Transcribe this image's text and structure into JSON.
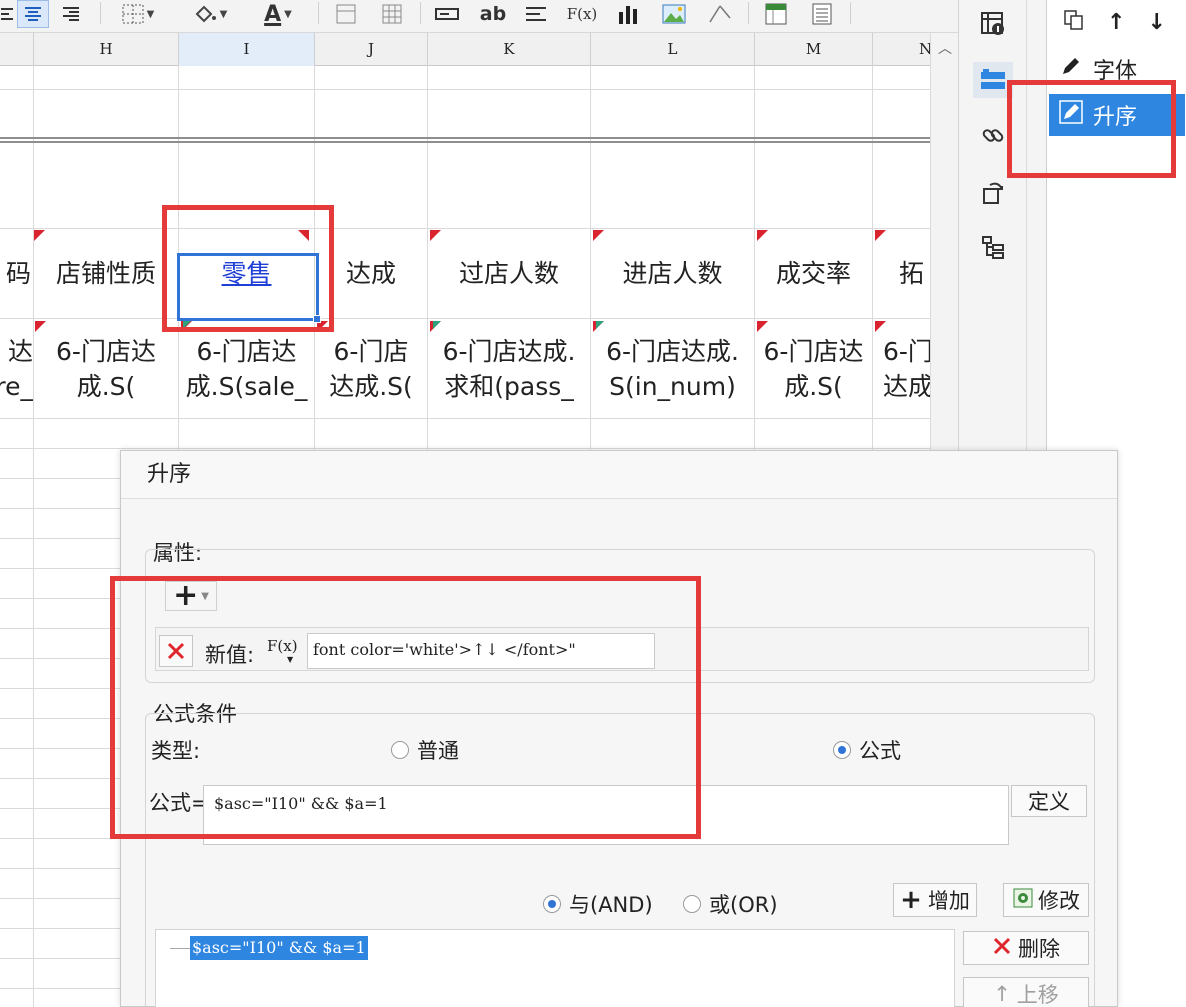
{
  "toolbar": {
    "icons": [
      "align-left-icon",
      "align-center-icon",
      "align-right-icon",
      "border-icon",
      "fill-color-icon",
      "font-color-icon",
      "merge-cells-icon",
      "table-icon",
      "text-field-icon",
      "ab-text-icon",
      "paragraph-icon",
      "formula-icon",
      "bar-chart-icon",
      "picture-icon",
      "slash-icon",
      "frozen-icon",
      "report-icon"
    ],
    "formula_label": "F(x)",
    "ab_label": "ab",
    "font_color_label": "A"
  },
  "sheet": {
    "columns": [
      "H",
      "I",
      "J",
      "K",
      "L",
      "M",
      "N"
    ],
    "selected_column": "I",
    "header_row": [
      "码",
      "店铺性质",
      "零售",
      "达成",
      "过店人数",
      "进店人数",
      "成交率",
      "拓"
    ],
    "data_row": [
      [
        "达",
        "re_"
      ],
      [
        "6-门店达",
        "成.S("
      ],
      [
        "6-门店达",
        "成.S(sale_"
      ],
      [
        "6-门店",
        "达成.S("
      ],
      [
        "6-门店达成.",
        "求和(pass_"
      ],
      [
        "6-门店达成.",
        "S(in_num)"
      ],
      [
        "6-门店达",
        "成.S("
      ],
      [
        "6-门",
        "达成"
      ]
    ]
  },
  "side_icons": [
    "cell-attr-icon",
    "condition-attr-icon",
    "hyperlink-icon",
    "widget-icon",
    "structure-icon"
  ],
  "panel": {
    "toolbar_icons": [
      "copy-icon",
      "arrow-up-icon",
      "arrow-down-icon"
    ],
    "items": [
      {
        "label": "字体",
        "icon": "pencil-icon"
      },
      {
        "label": "升序",
        "icon": "pencil-icon"
      }
    ]
  },
  "dialog": {
    "title": "升序",
    "attr_group_label": "属性:",
    "add_label": "+",
    "new_value_label": "新值:",
    "fx_label": "F(x)",
    "new_value": "font color='white'>↑↓ </font>\"",
    "formula_condition_label": "公式条件",
    "type_label": "类型:",
    "type_options": [
      {
        "label": "普通",
        "checked": false
      },
      {
        "label": "公式",
        "checked": true
      }
    ],
    "formula_label": "公式=",
    "formula_value": "$asc=\"I10\" && $a=1",
    "define_label": "定义",
    "logic_options": [
      {
        "label": "与(AND)",
        "checked": true
      },
      {
        "label": "或(OR)",
        "checked": false
      }
    ],
    "add_button": "增加",
    "modify_button": "修改",
    "delete_button": "删除",
    "move_up_button": "上移",
    "conditions": [
      "$asc=\"I10\" && $a=1"
    ]
  },
  "colors": {
    "accent": "#2f86e0",
    "highlight_red": "#e53a3a",
    "selection_blue": "#2f74d6"
  }
}
